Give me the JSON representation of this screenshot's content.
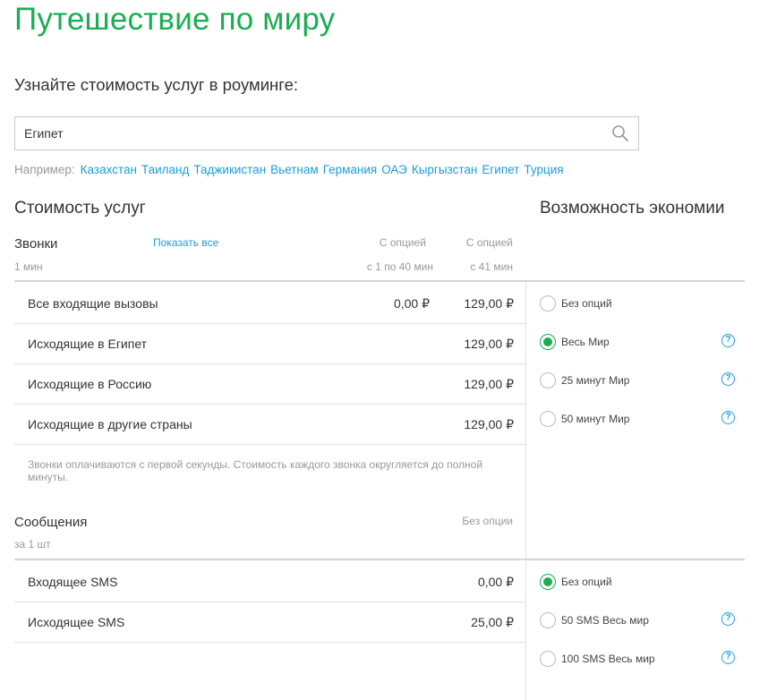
{
  "page": {
    "title": "Путешествие по миру",
    "subtitle": "Узнайте стоимость услуг в роуминге:"
  },
  "search": {
    "value": "Египет",
    "icon": "search-icon"
  },
  "examples": {
    "label": "Например:",
    "countries": [
      "Казахстан",
      "Таиланд",
      "Таджикистан",
      "Вьетнам",
      "Германия",
      "ОАЭ",
      "Кыргызстан",
      "Египет",
      "Турция"
    ]
  },
  "costs": {
    "heading": "Стоимость услуг",
    "calls": {
      "title": "Звонки",
      "unit": "1 мин",
      "show_all": "Показать все",
      "col1_title": "С опцией",
      "col1_sub": "с 1 по 40 мин",
      "col2_title": "С опцией",
      "col2_sub": "с 41 мин",
      "rows": [
        {
          "label": "Все входящие вызовы",
          "v1": "0,00 ₽",
          "v2": "129,00 ₽"
        },
        {
          "label": "Исходящие в Египет",
          "v1": "",
          "v2": "129,00 ₽"
        },
        {
          "label": "Исходящие в Россию",
          "v1": "",
          "v2": "129,00 ₽"
        },
        {
          "label": "Исходящие в другие страны",
          "v1": "",
          "v2": "129,00 ₽"
        }
      ],
      "note": "Звонки оплачиваются с первой секунды. Стоимость каждого звонка округляется до полной минуты."
    },
    "sms": {
      "title": "Сообщения",
      "unit": "за 1 шт",
      "col_title": "Без опции",
      "rows": [
        {
          "label": "Входящее SMS",
          "value": "0,00 ₽"
        },
        {
          "label": "Исходящее SMS",
          "value": "25,00 ₽"
        }
      ]
    }
  },
  "savings": {
    "heading": "Возможность экономии",
    "call_options": [
      {
        "label": "Без опций",
        "checked": false,
        "help": false
      },
      {
        "label": "Весь Мир",
        "checked": true,
        "help": true
      },
      {
        "label": "25 минут Мир",
        "checked": false,
        "help": true
      },
      {
        "label": "50 минут Мир",
        "checked": false,
        "help": true
      }
    ],
    "sms_options": [
      {
        "label": "Без опций",
        "checked": true,
        "help": false
      },
      {
        "label": "50 SMS Весь мир",
        "checked": false,
        "help": true
      },
      {
        "label": "100 SMS Весь мир",
        "checked": false,
        "help": true
      }
    ],
    "help_symbol": "?"
  },
  "colors": {
    "brand_green": "#1aae52",
    "link_blue": "#1a9ed6",
    "muted_text": "#999999"
  }
}
